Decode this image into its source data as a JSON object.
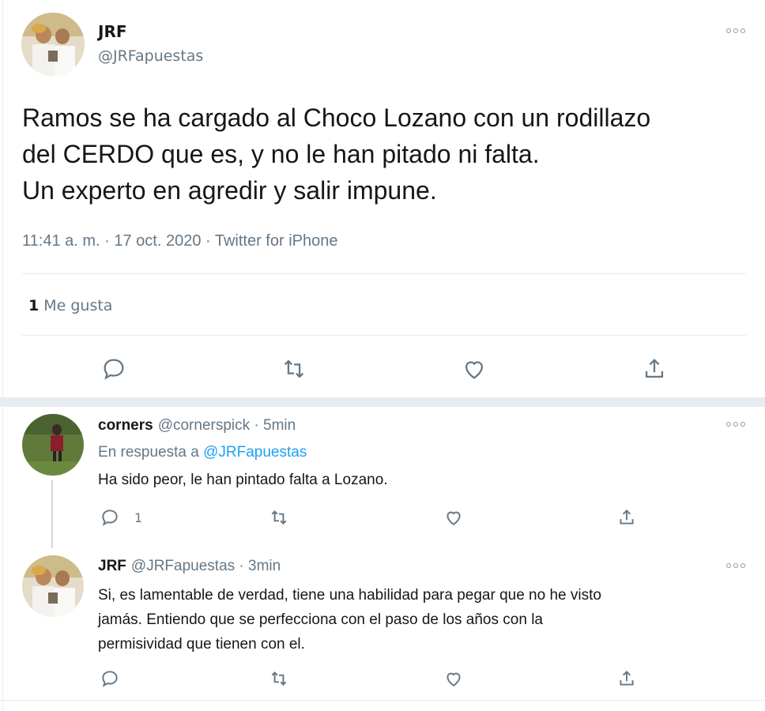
{
  "main_tweet": {
    "author_name": "JRF",
    "author_handle": "@JRFapuestas",
    "text_lines": [
      "Ramos se ha cargado al Choco Lozano con un rodillazo",
      "del CERDO que es, y no le han pitado ni falta.",
      "Un experto en agredir y salir impune."
    ],
    "timestamp": "11:41 a. m. · 17 oct. 2020 · Twitter for iPhone",
    "likes_count": "1",
    "likes_label": "Me gusta",
    "actions": [
      "reply-icon",
      "retweet-icon",
      "like-icon",
      "share-icon"
    ]
  },
  "replies": [
    {
      "author_name": "corners",
      "author_handle": "@cornerspick",
      "time": "· 5min",
      "reply_prefix": "En respuesta a",
      "reply_to": "@JRFapuestas",
      "text_lines": [
        "Ha sido peor, le han pintado falta a Lozano."
      ],
      "reply_count": "1"
    },
    {
      "author_name": "JRF",
      "author_handle": "@JRFapuestas",
      "time": "· 3min",
      "text_lines": [
        "Si, es lamentable de verdad, tiene una habilidad para pegar que no he visto",
        "jamás. Entiendo que se perfecciona con el paso de los años con la",
        "permisividad que tienen con el."
      ]
    }
  ],
  "colors": {
    "text": "#14171a",
    "secondary": "#657786",
    "link": "#1da1f2",
    "border": "#e6ecf0"
  }
}
